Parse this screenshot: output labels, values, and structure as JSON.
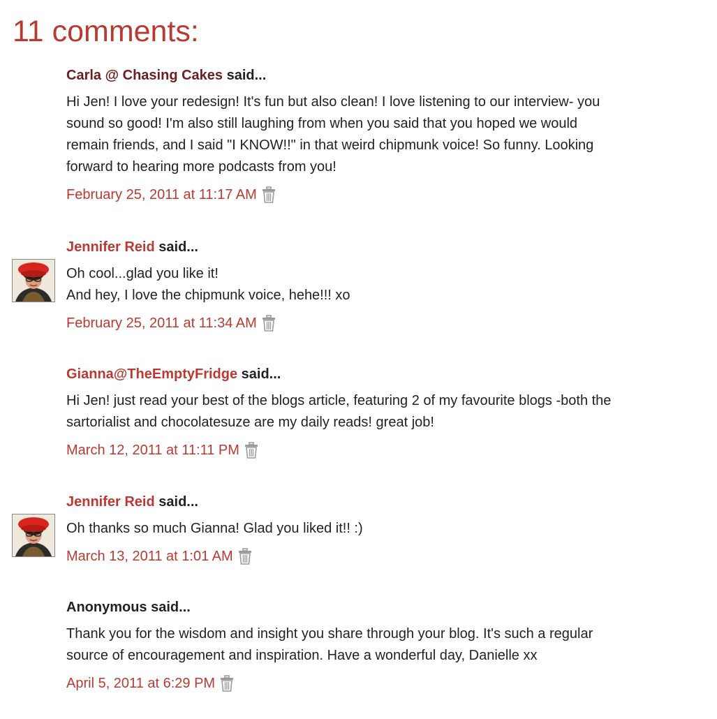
{
  "heading": "11 comments:",
  "said_suffix": "said...",
  "comments": [
    {
      "author": "Carla @ Chasing Cakes",
      "body_lines": [
        "Hi Jen! I love your redesign! It's fun but also clean! I love listening to our interview- you",
        "sound so good! I'm also still laughing from when you said that you hoped we would",
        "remain friends, and I said \"I KNOW!!\" in that weird chipmunk voice! So funny. Looking",
        "forward to hearing more podcasts from you!"
      ],
      "timestamp": "February 25, 2011 at 11:17 AM",
      "icon": "trash-icon"
    },
    {
      "author": "Jennifer Reid",
      "body_lines": [
        "Oh cool...glad you like it!",
        "And hey, I love the chipmunk voice, hehe!!! xo"
      ],
      "timestamp": "February 25, 2011 at 11:34 AM",
      "icon": "trash-icon"
    },
    {
      "author": "Gianna@TheEmptyFridge",
      "body_lines": [
        "Hi Jen! just read your best of the blogs article, featuring 2 of my favourite blogs -both the",
        "sartorialist and chocolatesuze are my daily reads! great job!"
      ],
      "timestamp": "March 12, 2011 at 11:11 PM",
      "icon": "trash-icon"
    },
    {
      "author": "Jennifer Reid",
      "body_lines": [
        "Oh thanks so much Gianna! Glad you liked it!! :)"
      ],
      "timestamp": "March 13, 2011 at 1:01 AM",
      "icon": "trash-icon"
    },
    {
      "author": "Anonymous",
      "body_lines": [
        "Thank you for the wisdom and insight you share through your blog. It's such a regular",
        "source of encouragement and inspiration. Have a wonderful day, Danielle xx"
      ],
      "timestamp": "April 5, 2011 at 6:29 PM",
      "icon": "trash-icon"
    }
  ],
  "colors": {
    "accent_red": "#b93a32",
    "author_dark_red": "#6b2020",
    "text": "#222222",
    "icon_gray": "#9a9a9a"
  }
}
